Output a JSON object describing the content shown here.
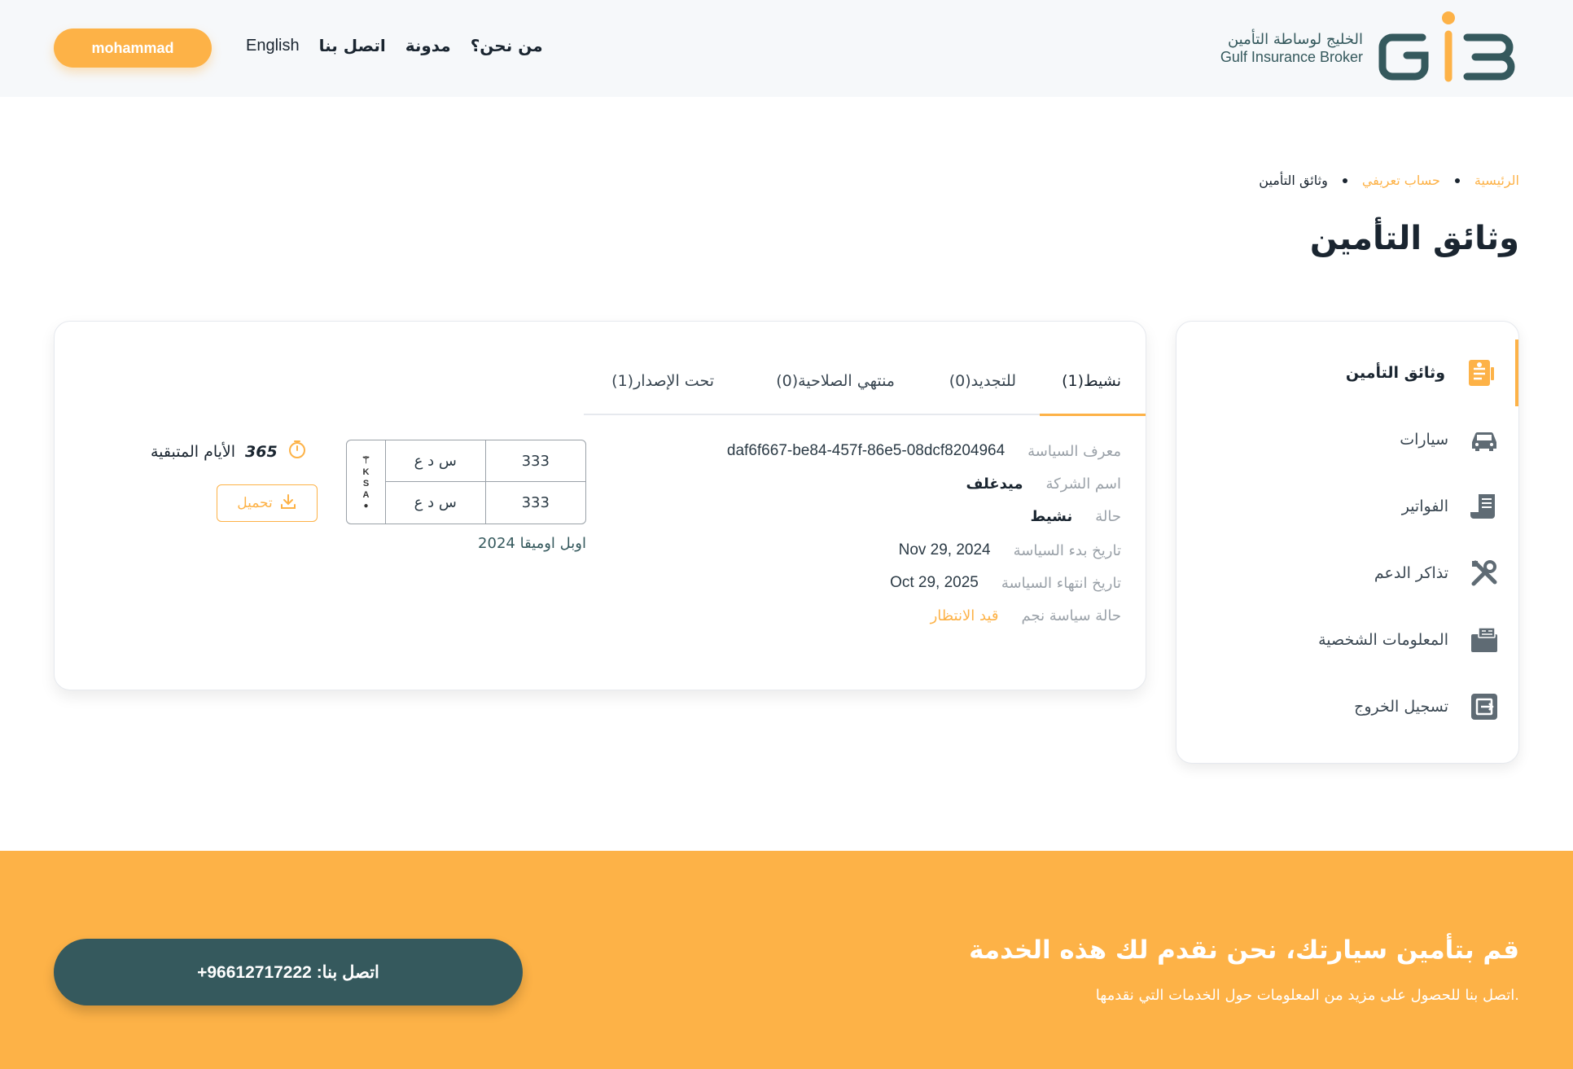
{
  "header": {
    "logo_ar": "الخليج لوساطة التأمين",
    "logo_en": "Gulf Insurance Broker",
    "nav": {
      "about": "من نحن؟",
      "blog": "مدونة",
      "contact": "اتصل بنا",
      "language": "English"
    },
    "user": "mohammad"
  },
  "breadcrumb": {
    "home": "الرئيسية",
    "profile": "حساب تعريفي",
    "current": "وثائق التأمين"
  },
  "page_title": "وثائق التأمين",
  "sidebar": {
    "items": [
      {
        "label": "وثائق التأمين",
        "icon": "document-icon"
      },
      {
        "label": "سيارات",
        "icon": "car-icon"
      },
      {
        "label": "الفواتير",
        "icon": "invoice-icon"
      },
      {
        "label": "تذاكر الدعم",
        "icon": "tools-icon"
      },
      {
        "label": "المعلومات الشخصية",
        "icon": "id-card-icon"
      },
      {
        "label": "تسجيل الخروج",
        "icon": "logout-icon"
      }
    ]
  },
  "tabs": {
    "active": "نشيط(1)",
    "renewal": "للتجديد(0)",
    "expired": "منتهي الصلاحية(0)",
    "issuing": "تحت الإصدار(1)"
  },
  "policy": {
    "id_label": "معرف السياسة",
    "id_value": "daf6f667-be84-457f-86e5-08dcf8204964",
    "company_label": "اسم الشركة",
    "company_value": "ميدغلف",
    "status_label": "حالة",
    "status_value": "نشيط",
    "start_label": "تاريخ بدء السياسة",
    "start_value": "Nov 29, 2024",
    "end_label": "تاريخ انتهاء السياسة",
    "end_value": "Oct 29, 2025",
    "najm_label": "حالة سياسة نجم",
    "najm_value": "قيد الانتظار"
  },
  "plate": {
    "ksa": [
      "K",
      "S",
      "A"
    ],
    "num_top": "333",
    "letters_top": "س د ع",
    "num_bottom": "333",
    "letters_bottom": "س د ع",
    "car_model": "اوبل اوميقا 2024"
  },
  "remaining": {
    "days": "365",
    "label": "الأيام المتبقية"
  },
  "download_label": "تحميل",
  "footer": {
    "title": "قم بتأمين سيارتك، نحن نقدم لك هذه الخدمة",
    "subtitle": "اتصل بنا للحصول على مزيد من المعلومات حول الخدمات التي نقدمها.",
    "contact": "اتصل بنا: 96612717222+"
  },
  "colors": {
    "accent": "#fdb247",
    "brand_dark": "#35595d",
    "header_bg": "#f6f8fa"
  }
}
